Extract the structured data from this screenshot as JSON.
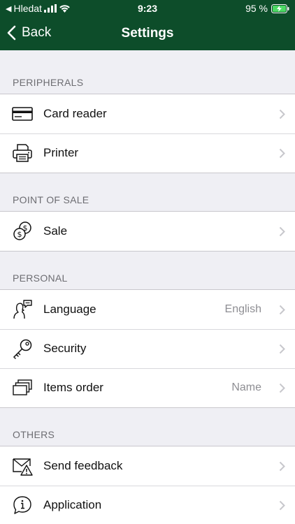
{
  "status": {
    "carrier_back": "Hledat",
    "time": "9:23",
    "battery": "95 %"
  },
  "nav": {
    "back_label": "Back",
    "title": "Settings"
  },
  "sections": {
    "peripherals": {
      "header": "PERIPHERALS",
      "card_reader": "Card reader",
      "printer": "Printer"
    },
    "point_of_sale": {
      "header": "POINT OF SALE",
      "sale": "Sale"
    },
    "personal": {
      "header": "PERSONAL",
      "language": "Language",
      "language_value": "English",
      "security": "Security",
      "items_order": "Items order",
      "items_order_value": "Name"
    },
    "others": {
      "header": "OTHERS",
      "send_feedback": "Send feedback",
      "application": "Application"
    }
  },
  "colors": {
    "header_bg": "#0d4d2a",
    "background": "#efeff4",
    "battery_green": "#4cd964"
  }
}
